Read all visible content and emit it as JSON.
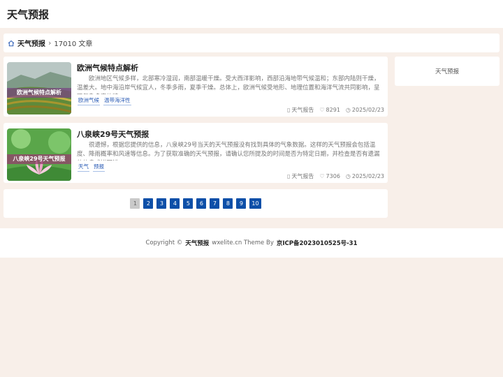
{
  "header": {
    "site_title": "天气预报"
  },
  "breadcrumb": {
    "site": "天气预报",
    "count": "17010 文章"
  },
  "articles": [
    {
      "title": "欧洲气候特点解析",
      "thumb_caption": "欧洲气候特点解析",
      "excerpt": "欧洲地区气候多样，北部寒冷湿润，南部温暖干燥。受大西洋影响，西部沿海地带气候温和；东部内陆则干燥，温差大。地中海沿岸气候宜人，冬季多雨，夏季干燥。总体上，欧洲气候受地形、地理位置和海洋气流共同影响，呈现复杂多变的特…",
      "tags": [
        "欧洲气候",
        "温带海洋性"
      ],
      "category": "天气报告",
      "likes": "8291",
      "date": "2025/02/23"
    },
    {
      "title": "八泉峡29号天气预报",
      "thumb_caption": "八泉峡29号天气预报",
      "excerpt": "很遗憾，根据您提供的信息，八泉峡29号当天的天气预报没有找到具体的气象数据。这样的天气预报会包括温度、降雨概率和风速等信息。为了获取准确的天气预报，请确认您所提及的时间是否为特定日期，并检查是否有遗漏的信息或拼写错…",
      "tags": [
        "天气",
        "预报"
      ],
      "category": "天气报告",
      "likes": "7306",
      "date": "2025/02/23"
    }
  ],
  "pagination": [
    "1",
    "2",
    "3",
    "4",
    "5",
    "6",
    "7",
    "8",
    "9",
    "10"
  ],
  "sidebar": {
    "label": "天气预报"
  },
  "footer": {
    "copyright": "Copyright ©",
    "site": "天气预报",
    "theme": "wxelite.cn Theme By",
    "icp": "京ICP备2023010525号-31"
  },
  "icons": {
    "home": "home-icon",
    "chevron": "chevron-right-icon",
    "category": "book-icon",
    "likes": "heart-icon",
    "date": "clock-icon"
  },
  "colors": {
    "accent": "#0d4fa8",
    "page_bg": "#f8efe9"
  }
}
